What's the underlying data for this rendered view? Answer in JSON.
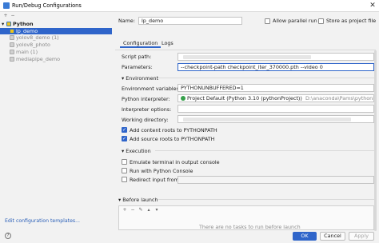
{
  "window": {
    "title": "Run/Debug Configurations"
  },
  "tree": {
    "items": [
      {
        "label": "Python",
        "suffix": ""
      },
      {
        "label": "lp_demo",
        "suffix": ""
      },
      {
        "label": "yolov8_demo",
        "suffix": "(1)"
      },
      {
        "label": "yolov8_photo",
        "suffix": ""
      },
      {
        "label": "main",
        "suffix": "(1)"
      },
      {
        "label": "mediapipe_demo",
        "suffix": ""
      }
    ],
    "edit_templates": "Edit configuration templates..."
  },
  "form": {
    "name_label": "Name:",
    "name_value": "lp_demo",
    "allow_parallel_label": "Allow parallel run",
    "store_label": "Store as project file",
    "tabs": [
      "Configuration",
      "Logs"
    ],
    "script_path_label": "Script path:",
    "parameters_label": "Parameters:",
    "parameters_value": "--checkpoint-path checkpoint_iter_370000.pth --video 0",
    "environment_section": "Environment",
    "env_vars_label": "Environment variables:",
    "env_vars_value": "PYTHONUNBUFFERED=1",
    "interpreter_label": "Python interpreter:",
    "interpreter_value": "Project Default (Python 3.10 (pythonProject))",
    "interpreter_path": "D:\\anaconda\\Pams\\pythonProject\\python",
    "interp_options_label": "Interpreter options:",
    "workdir_label": "Working directory:",
    "add_content_roots": "Add content roots to PYTHONPATH",
    "add_source_roots": "Add source roots to PYTHONPATH",
    "execution_section": "Execution",
    "emulate_terminal": "Emulate terminal in output console",
    "run_console": "Run with Python Console",
    "redirect_input": "Redirect input from:",
    "before_launch": "Before launch",
    "no_tasks": "There are no tasks to run before launch"
  },
  "buttons": {
    "ok": "OK",
    "cancel": "Cancel",
    "apply": "Apply"
  },
  "colors": {
    "accent": "#2f65ca",
    "link": "#2a5fb8"
  }
}
